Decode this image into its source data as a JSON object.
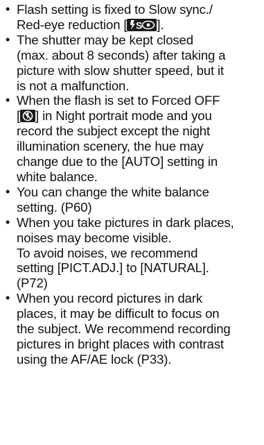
{
  "bullets": [
    {
      "lines": [
        {
          "pre": "Flash setting is fixed to Slow sync./"
        },
        {
          "pre": "Red-eye reduction [",
          "icon": "flash-slow-sync-red-eye-icon",
          "post": "]."
        }
      ]
    },
    {
      "lines": [
        {
          "pre": "The shutter may be kept closed"
        },
        {
          "pre": "(max. about 8 seconds) after taking a"
        },
        {
          "pre": "picture with slow shutter speed, but it"
        },
        {
          "pre": "is not a malfunction."
        }
      ]
    },
    {
      "lines": [
        {
          "pre": "When the flash is set to Forced OFF"
        },
        {
          "pre": "[",
          "icon": "flash-forced-off-icon",
          "post": "] in Night portrait mode and you"
        },
        {
          "pre": "record the subject except the night"
        },
        {
          "pre": "illumination scenery, the hue may"
        },
        {
          "pre": "change due to the [AUTO] setting in"
        },
        {
          "pre": "white balance."
        }
      ]
    },
    {
      "lines": [
        {
          "pre": "You can change the white balance"
        },
        {
          "pre": "setting. (P60)"
        }
      ]
    },
    {
      "lines": [
        {
          "pre": "When you take pictures in dark places,"
        },
        {
          "pre": "noises may become visible."
        },
        {
          "pre": "To avoid noises, we recommend"
        },
        {
          "pre": "setting [PICT.ADJ.] to [NATURAL]."
        },
        {
          "pre": "(P72)"
        }
      ]
    },
    {
      "lines": [
        {
          "pre": "When you record pictures in dark"
        },
        {
          "pre": "places, it may be difficult to focus on"
        },
        {
          "pre": "the subject. We recommend recording"
        },
        {
          "pre": "pictures in bright places with contrast"
        },
        {
          "pre": "using the AF/AE lock (P33)."
        }
      ]
    }
  ]
}
